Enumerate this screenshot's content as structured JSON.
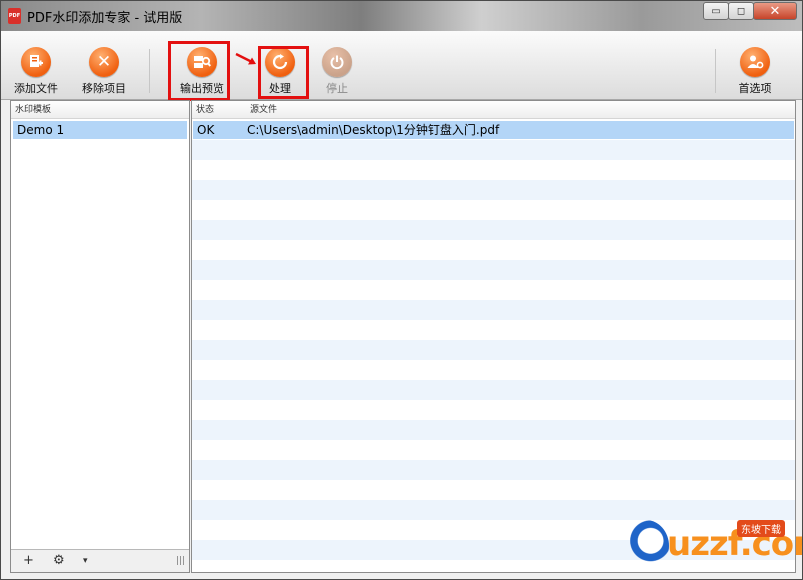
{
  "window": {
    "title": "PDF水印添加专家 - 试用版",
    "app_icon": "PDF"
  },
  "title_buttons": {
    "minimize": "▭",
    "maximize": "◻",
    "close": "✕"
  },
  "toolbar": {
    "add_file": "添加文件",
    "remove_item": "移除项目",
    "preview": "输出预览",
    "process": "处理",
    "stop": "停止",
    "preferences": "首选项"
  },
  "left_panel": {
    "header": "水印模板",
    "templates": [
      "Demo 1"
    ],
    "footer": {
      "add": "+",
      "settings": "⚙",
      "dropdown": "▾"
    }
  },
  "right_panel": {
    "headers": {
      "status": "状态",
      "source": "源文件"
    },
    "rows": [
      {
        "status": "OK",
        "path": "C:\\Users\\admin\\Desktop\\1分钟钉盘入门.pdf"
      }
    ]
  },
  "watermark": {
    "brand": "uzzf.com",
    "tag": "东坡下载"
  },
  "colors": {
    "accent": "#f06010",
    "selection": "#b3d5f7",
    "highlight": "#e31010",
    "close": "#c7442a"
  }
}
